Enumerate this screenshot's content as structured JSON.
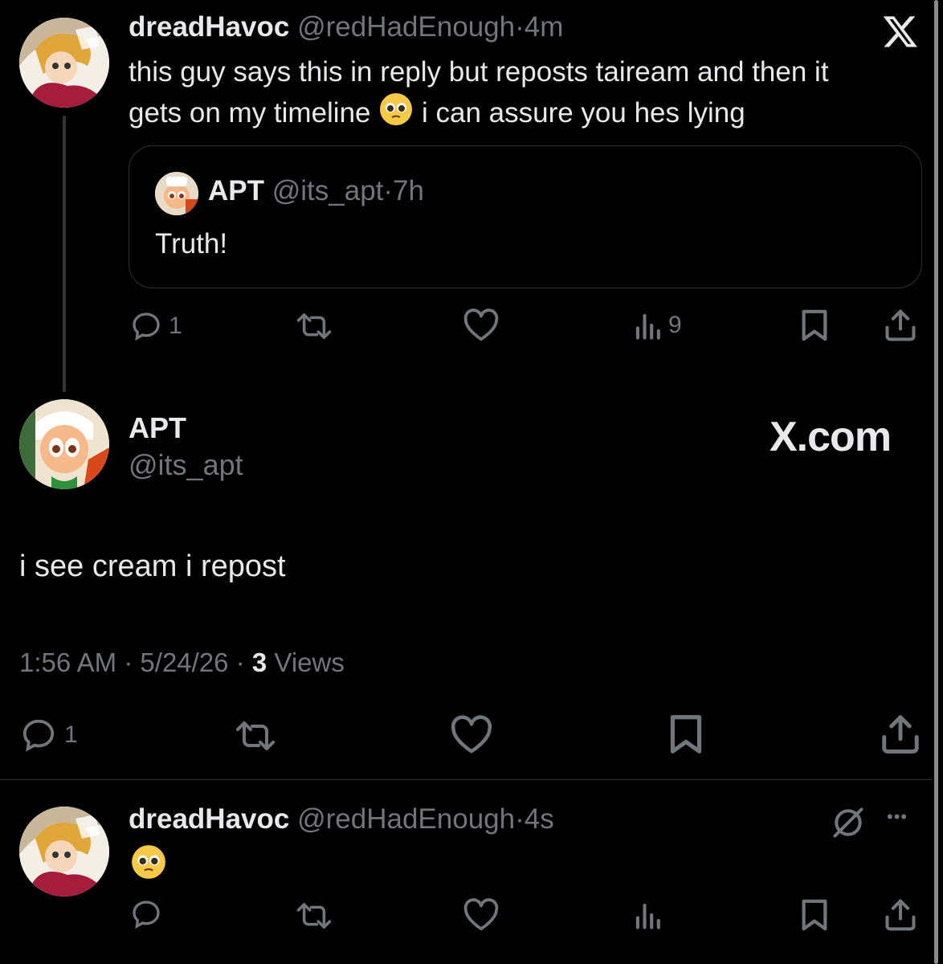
{
  "first_post": {
    "display_name": "dreadHavoc",
    "handle": "@redHadEnough",
    "separator": "·",
    "time": "4m",
    "text_line1": "this guy says this in reply but reposts taiream and then it",
    "text_line2_a": "gets on my timeline",
    "text_line2_b": "i can assure you hes lying",
    "quote": {
      "display_name": "APT",
      "handle": "@its_apt",
      "separator": "·",
      "time": "7h",
      "text": "Truth!"
    },
    "actions": {
      "reply_count": "1",
      "views_count": "9"
    }
  },
  "main_post": {
    "display_name": "APT",
    "handle": "@its_apt",
    "watermark": "X.com",
    "text": "i see cream i repost",
    "meta": {
      "time": "1:56 AM",
      "sep1": "·",
      "date": "5/24/26",
      "sep2": "·",
      "views_number": "3",
      "views_label": "Views"
    },
    "actions": {
      "reply_count": "1"
    }
  },
  "reply_post": {
    "display_name": "dreadHavoc",
    "handle": "@redHadEnough",
    "separator": "·",
    "time": "4s",
    "more": "•••"
  },
  "icons": {
    "x_logo": "x-logo-icon",
    "reply": "reply-icon",
    "repost": "repost-icon",
    "like": "heart-icon",
    "views": "views-icon",
    "bookmark": "bookmark-icon",
    "share": "share-icon",
    "grok": "grok-icon",
    "emoji": "pleading-face-emoji"
  },
  "colors": {
    "background": "#000000",
    "primary_text": "#e7e9ea",
    "secondary_text": "#71767b",
    "border": "#2f3336"
  }
}
